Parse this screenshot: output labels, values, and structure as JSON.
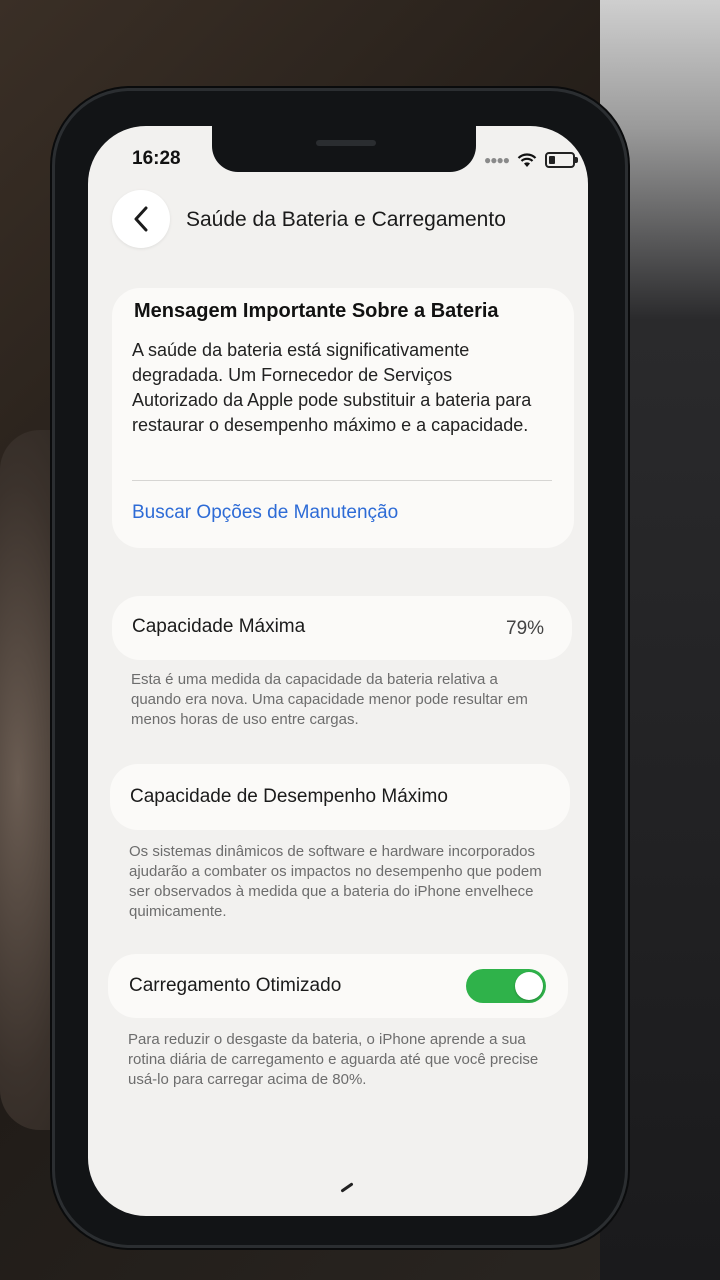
{
  "status_bar": {
    "time": "16:28"
  },
  "nav": {
    "title": "Saúde da Bateria e Carregamento"
  },
  "message": {
    "title": "Mensagem Importante Sobre a Bateria",
    "body": "A saúde da bateria está significativamente degradada. Um Fornecedor de Serviços Autorizado da Apple pode substituir a bateria para restaurar o desempenho máximo e a capacidade.",
    "link": "Buscar Opções de Manutenção"
  },
  "max_capacity": {
    "label": "Capacidade Máxima",
    "value": "79%",
    "note": "Esta é uma medida da capacidade da bateria relativa a quando era nova. Uma capacidade menor pode resultar em menos horas de uso entre cargas."
  },
  "peak_performance": {
    "label": "Capacidade de Desempenho Máximo",
    "note": "Os sistemas dinâmicos de software e hardware incorporados ajudarão a combater os impactos no desempenho que podem ser observados à medida que a bateria do iPhone envelhece quimicamente."
  },
  "optimized_charging": {
    "label": "Carregamento Otimizado",
    "enabled": true,
    "note": "Para reduzir o desgaste da bateria, o iPhone aprende a sua rotina diária de carregamento e aguarda até que você precise usá-lo para carregar acima de 80%."
  },
  "colors": {
    "link": "#2d6bd6",
    "toggle_on": "#2fb24a"
  },
  "icons": [
    "chevron-left-icon",
    "wifi-icon",
    "battery-icon",
    "cellular-signal-icon"
  ]
}
